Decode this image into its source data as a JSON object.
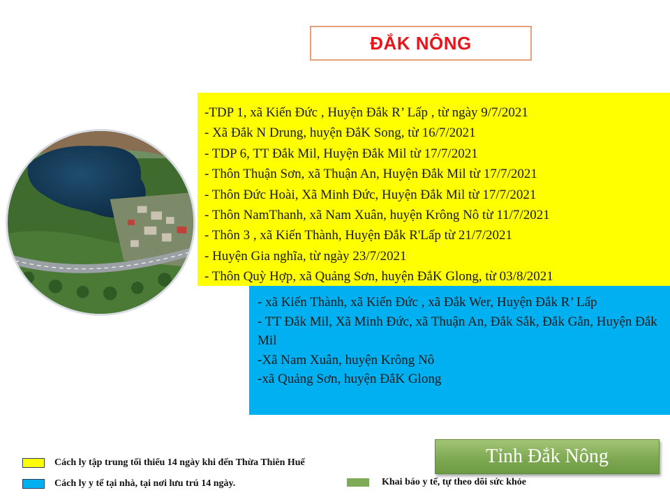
{
  "header": {
    "title": "ĐẮK NÔNG"
  },
  "colors": {
    "title_text": "#e8161a",
    "title_border": "#e8a07a",
    "concentrated_quarantine": "#ffff00",
    "home_quarantine": "#00b0f0",
    "medical_declaration": "#80ab56"
  },
  "photo": {
    "icon": "aerial-lake-photo"
  },
  "concentrated_areas": [
    "-TDP 1, xã Kiến Đức , Huyện Đắk R’ Lấp , từ ngày 9/7/2021",
    "- Xã Đắk N Drung, huyện ĐắK Song, từ 16/7/2021",
    "- TDP 6, TT Đắk Mil, Huyện Đắk Mil từ 17/7/2021",
    "- Thôn Thuận Sơn, xã Thuận An, Huyện Đắk Mil từ 17/7/2021",
    "- Thôn Đức Hoài, Xã Minh Đức, Huyện Đắk Mil từ 17/7/2021",
    "- Thôn NamThanh, xã Nam Xuân, huyện Krông Nô từ 11/7/2021",
    "- Thôn 3 , xã Kiến Thành, Huyện Đắk R'Lấp từ 21/7/2021",
    "-    Huyện Gia nghĩa, từ ngày 23/7/2021",
    "-    Thôn Quỳ Hợp, xã Quảng Sơn, huyện ĐắK Glong, từ 03/8/2021"
  ],
  "home_areas": [
    "- xã Kiến Thành, xã Kiến Đức , xã Đắk Wer,  Huyện Đắk R’ Lấp",
    "- TT Đắk Mil, Xã Minh Đức, xã Thuận An, Đắk Sắk, Đắk Gằn, Huyện Đắk Mil",
    "-Xã Nam Xuân, huyện Krông Nô",
    "-xã Quảng Sơn, huyện ĐắK Glong"
  ],
  "province_button": {
    "label": "Tỉnh Đắk Nông"
  },
  "legend": {
    "concentrated": "Cách ly tập trung tối thiểu  14 ngày khi đến Thừa Thiên Huế",
    "home": "Cách ly y tế tại nhà, tại nơi lưu trú 14 ngày.",
    "declaration": "Khai báo y tế, tự theo dõi sức khỏe"
  }
}
